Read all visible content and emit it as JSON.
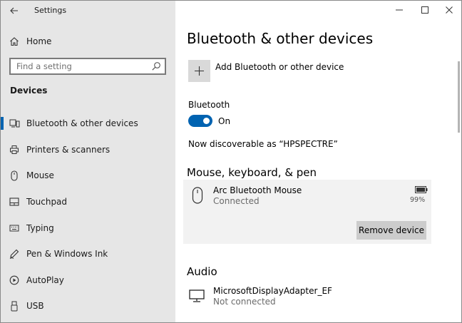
{
  "window": {
    "app_title": "Settings",
    "back_icon": "back-arrow-icon",
    "minimize_icon": "minimize-icon",
    "maximize_icon": "maximize-icon",
    "close_icon": "close-icon"
  },
  "sidebar": {
    "home_label": "Home",
    "home_icon": "home-icon",
    "search": {
      "placeholder": "Find a setting",
      "value": "",
      "icon": "search-icon"
    },
    "section_title": "Devices",
    "items": [
      {
        "label": "Bluetooth & other devices",
        "icon": "bluetooth-devices-icon",
        "active": true
      },
      {
        "label": "Printers & scanners",
        "icon": "printer-icon",
        "active": false
      },
      {
        "label": "Mouse",
        "icon": "mouse-icon",
        "active": false
      },
      {
        "label": "Touchpad",
        "icon": "touchpad-icon",
        "active": false
      },
      {
        "label": "Typing",
        "icon": "keyboard-icon",
        "active": false
      },
      {
        "label": "Pen & Windows Ink",
        "icon": "pen-icon",
        "active": false
      },
      {
        "label": "AutoPlay",
        "icon": "autoplay-icon",
        "active": false
      },
      {
        "label": "USB",
        "icon": "usb-icon",
        "active": false
      }
    ]
  },
  "main": {
    "title": "Bluetooth & other devices",
    "add_device": {
      "label": "Add Bluetooth or other device",
      "icon": "plus-icon"
    },
    "bluetooth": {
      "label": "Bluetooth",
      "state": "On",
      "enabled": true
    },
    "discoverable_text": "Now discoverable as “HPSPECTRE”",
    "groups": [
      {
        "heading": "Mouse, keyboard, & pen",
        "devices": [
          {
            "name": "Arc Bluetooth Mouse",
            "status": "Connected",
            "icon": "mouse-icon",
            "battery": "99%",
            "battery_icon": "battery-icon",
            "action_label": "Remove device"
          }
        ]
      },
      {
        "heading": "Audio",
        "devices": [
          {
            "name": "MicrosoftDisplayAdapter_EF",
            "status": "Not connected",
            "icon": "monitor-icon"
          }
        ]
      }
    ]
  },
  "colors": {
    "accent": "#0063b1",
    "sidebar_bg": "#e6e6e6",
    "card_bg": "#f2f2f2",
    "button_bg": "#cccccc"
  }
}
